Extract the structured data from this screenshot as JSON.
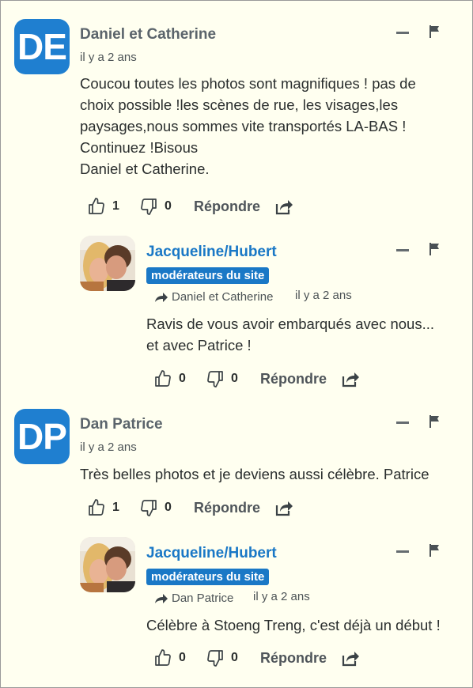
{
  "comments": [
    {
      "avatar_initials": "DE",
      "author": "Daniel et Catherine",
      "time": "il y a 2 ans",
      "lines": [
        "Coucou toutes les photos sont magnifiques ! pas de",
        "choix possible !les scènes de rue, les visages,les",
        "paysages,nous sommes vite transportés LA-BAS !",
        "Continuez !Bisous",
        "Daniel et Catherine."
      ],
      "likes": "1",
      "dislikes": "0",
      "reply_label": "Répondre",
      "reply": {
        "author": "Jacqueline/Hubert",
        "badge": "modérateurs du site",
        "reply_to": "Daniel et Catherine",
        "time": "il y a 2 ans",
        "lines": [
          "Ravis de vous avoir embarqués avec nous...",
          "et avec Patrice !"
        ],
        "likes": "0",
        "dislikes": "0",
        "reply_label": "Répondre"
      }
    },
    {
      "avatar_initials": "DP",
      "author": "Dan Patrice",
      "time": "il y a 2 ans",
      "lines": [
        "Très belles photos et je deviens aussi célèbre. Patrice"
      ],
      "likes": "1",
      "dislikes": "0",
      "reply_label": "Répondre",
      "reply": {
        "author": "Jacqueline/Hubert",
        "badge": "modérateurs du site",
        "reply_to": "Dan Patrice",
        "time": "il y a 2 ans",
        "lines": [
          "Célèbre à Stoeng Treng, c'est déjà un début !"
        ],
        "likes": "0",
        "dislikes": "0",
        "reply_label": "Répondre"
      }
    }
  ],
  "colors": {
    "accent": "#1a78c6",
    "avatar_bg": "#1f7fd0",
    "background": "#fffff0"
  },
  "icons": [
    "minus-icon",
    "flag-icon",
    "thumbs-up-icon",
    "thumbs-down-icon",
    "share-icon",
    "reply-arrow-icon"
  ]
}
